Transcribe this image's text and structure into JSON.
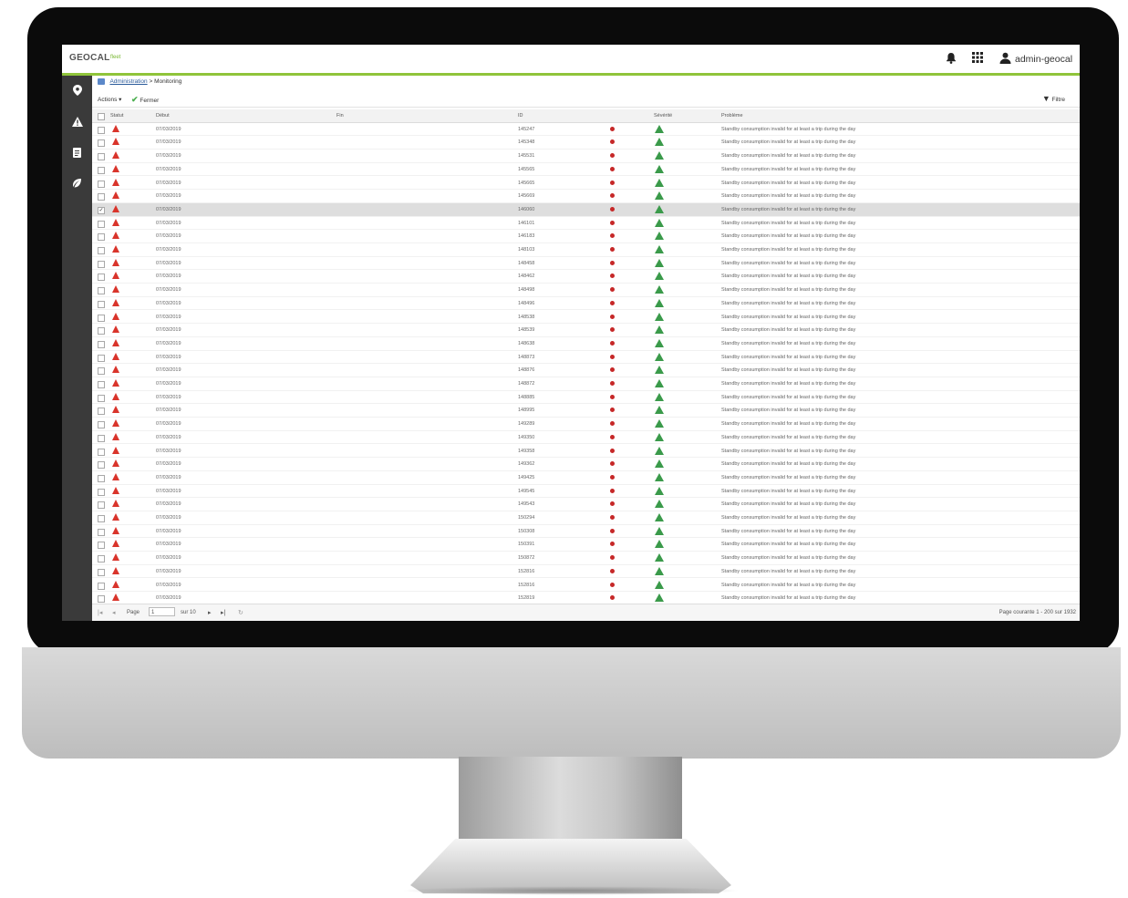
{
  "app": {
    "logo": "GEOCAL",
    "logo_sub": "fleet",
    "user": "admin-geocal",
    "icons": [
      "bell-icon",
      "apps-grid-icon",
      "user-icon"
    ]
  },
  "sidebar": {
    "items": [
      {
        "icon": "map-pin-icon",
        "glyph": "⚲"
      },
      {
        "icon": "alert-icon",
        "glyph": "▲"
      },
      {
        "icon": "document-icon",
        "glyph": "▤"
      },
      {
        "icon": "leaf-icon",
        "glyph": "❦"
      }
    ]
  },
  "breadcrumb": {
    "root": "Administration",
    "separator": ">",
    "current": "Monitoring"
  },
  "toolbar": {
    "actions_label": "Actions",
    "close_label": "Fermer",
    "filter_label": "Filtre"
  },
  "table": {
    "columns": {
      "status": "Statut",
      "start": "Début",
      "end": "Fin",
      "id": "ID",
      "severity": "Sévérité",
      "problem": "Problème"
    },
    "rows": [
      {
        "date": "07/03/2019",
        "id": "145247",
        "problem": "Standby consumption invalid for at least a trip during the day"
      },
      {
        "date": "07/03/2019",
        "id": "145348",
        "problem": "Standby consumption invalid for at least a trip during the day"
      },
      {
        "date": "07/03/2019",
        "id": "145531",
        "problem": "Standby consumption invalid for at least a trip during the day"
      },
      {
        "date": "07/03/2019",
        "id": "145565",
        "problem": "Standby consumption invalid for at least a trip during the day"
      },
      {
        "date": "07/03/2019",
        "id": "145665",
        "problem": "Standby consumption invalid for at least a trip during the day"
      },
      {
        "date": "07/03/2019",
        "id": "145669",
        "problem": "Standby consumption invalid for at least a trip during the day"
      },
      {
        "date": "07/03/2019",
        "id": "146060",
        "problem": "Standby consumption invalid for at least a trip during the day",
        "selected": true
      },
      {
        "date": "07/03/2019",
        "id": "146101",
        "problem": "Standby consumption invalid for at least a trip during the day"
      },
      {
        "date": "07/03/2019",
        "id": "146183",
        "problem": "Standby consumption invalid for at least a trip during the day"
      },
      {
        "date": "07/03/2019",
        "id": "148103",
        "problem": "Standby consumption invalid for at least a trip during the day"
      },
      {
        "date": "07/03/2019",
        "id": "148458",
        "problem": "Standby consumption invalid for at least a trip during the day"
      },
      {
        "date": "07/03/2019",
        "id": "148462",
        "problem": "Standby consumption invalid for at least a trip during the day"
      },
      {
        "date": "07/03/2019",
        "id": "148498",
        "problem": "Standby consumption invalid for at least a trip during the day"
      },
      {
        "date": "07/03/2019",
        "id": "148496",
        "problem": "Standby consumption invalid for at least a trip during the day"
      },
      {
        "date": "07/03/2019",
        "id": "148538",
        "problem": "Standby consumption invalid for at least a trip during the day"
      },
      {
        "date": "07/03/2019",
        "id": "148539",
        "problem": "Standby consumption invalid for at least a trip during the day"
      },
      {
        "date": "07/03/2019",
        "id": "148638",
        "problem": "Standby consumption invalid for at least a trip during the day"
      },
      {
        "date": "07/03/2019",
        "id": "148873",
        "problem": "Standby consumption invalid for at least a trip during the day"
      },
      {
        "date": "07/03/2019",
        "id": "148876",
        "problem": "Standby consumption invalid for at least a trip during the day"
      },
      {
        "date": "07/03/2019",
        "id": "148872",
        "problem": "Standby consumption invalid for at least a trip during the day"
      },
      {
        "date": "07/03/2019",
        "id": "148885",
        "problem": "Standby consumption invalid for at least a trip during the day"
      },
      {
        "date": "07/03/2019",
        "id": "148995",
        "problem": "Standby consumption invalid for at least a trip during the day"
      },
      {
        "date": "07/03/2019",
        "id": "149289",
        "problem": "Standby consumption invalid for at least a trip during the day"
      },
      {
        "date": "07/03/2019",
        "id": "149350",
        "problem": "Standby consumption invalid for at least a trip during the day"
      },
      {
        "date": "07/03/2019",
        "id": "149358",
        "problem": "Standby consumption invalid for at least a trip during the day"
      },
      {
        "date": "07/03/2019",
        "id": "149362",
        "problem": "Standby consumption invalid for at least a trip during the day"
      },
      {
        "date": "07/03/2019",
        "id": "149425",
        "problem": "Standby consumption invalid for at least a trip during the day"
      },
      {
        "date": "07/03/2019",
        "id": "149545",
        "problem": "Standby consumption invalid for at least a trip during the day"
      },
      {
        "date": "07/03/2019",
        "id": "149543",
        "problem": "Standby consumption invalid for at least a trip during the day"
      },
      {
        "date": "07/03/2019",
        "id": "150294",
        "problem": "Standby consumption invalid for at least a trip during the day"
      },
      {
        "date": "07/03/2019",
        "id": "150308",
        "problem": "Standby consumption invalid for at least a trip during the day"
      },
      {
        "date": "07/03/2019",
        "id": "150391",
        "problem": "Standby consumption invalid for at least a trip during the day"
      },
      {
        "date": "07/03/2019",
        "id": "150872",
        "problem": "Standby consumption invalid for at least a trip during the day"
      },
      {
        "date": "07/03/2019",
        "id": "152816",
        "problem": "Standby consumption invalid for at least a trip during the day"
      },
      {
        "date": "07/03/2019",
        "id": "152816",
        "problem": "Standby consumption invalid for at least a trip during the day"
      },
      {
        "date": "07/03/2019",
        "id": "152819",
        "problem": "Standby consumption invalid for at least a trip during the day"
      }
    ]
  },
  "pager": {
    "page_label": "Page",
    "page_value": "1",
    "of_label": "sur 10",
    "summary": "Page courante 1 - 200 sur 1932"
  },
  "colors": {
    "accent": "#8fc43a",
    "status_red": "#d9342b",
    "severity_green": "#3a9a4a",
    "sidebar": "#3a3a3a"
  }
}
